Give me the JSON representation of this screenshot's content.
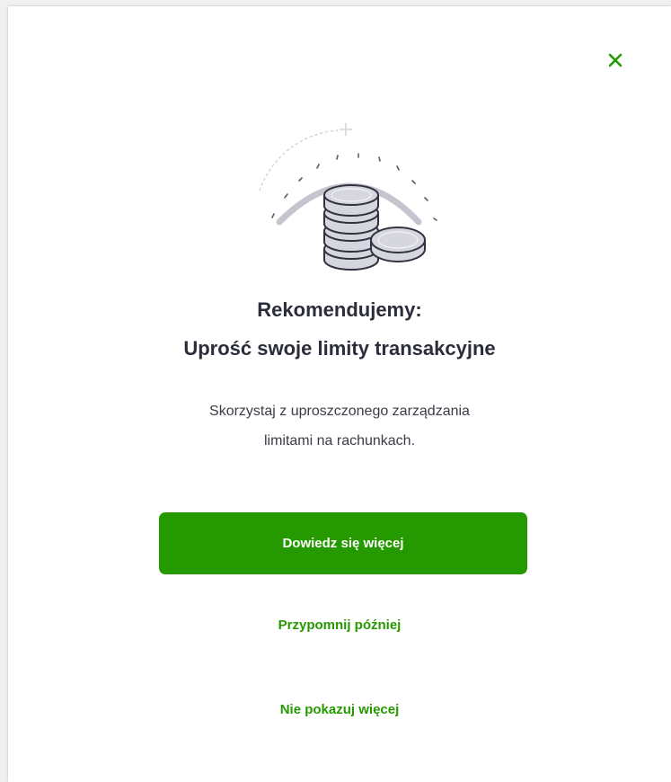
{
  "dialog": {
    "close_icon": "close-icon",
    "title_line1": "Rekomendujemy:",
    "title_line2": "Uprość swoje limity transakcyjne",
    "description_line1": "Skorzystaj z uproszczonego zarządzania",
    "description_line2": "limitami na rachunkach.",
    "primary_button_label": "Dowiedz się więcej",
    "remind_later_label": "Przypomnij później",
    "dont_show_again_label": "Nie pokazuj więcej",
    "illustration": "coins-gauge-illustration"
  },
  "colors": {
    "accent": "#259a00",
    "title": "#2b2d3a",
    "text": "#3a3c47"
  }
}
